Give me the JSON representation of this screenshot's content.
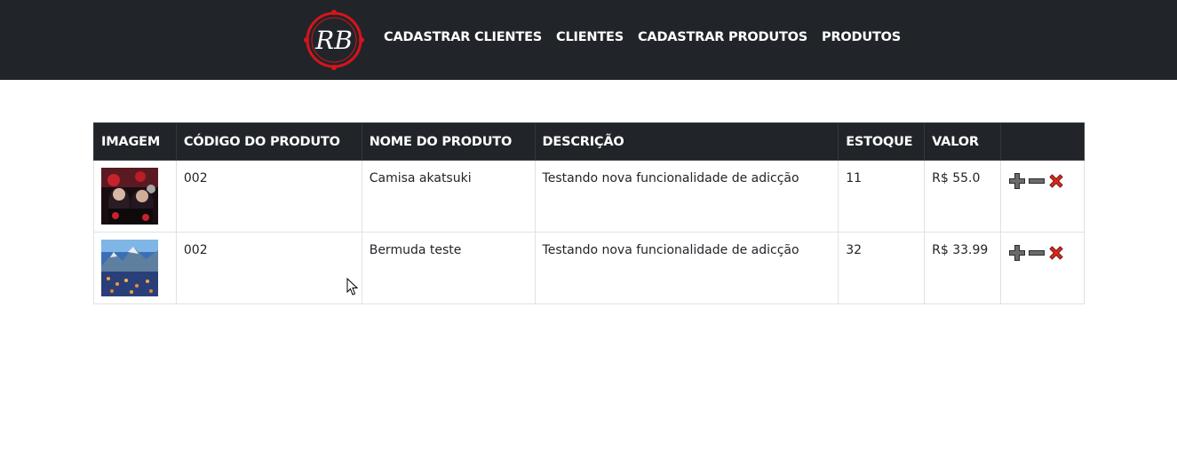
{
  "navbar": {
    "logo_text": "RB",
    "links": [
      {
        "label": "CADASTRAR CLIENTES"
      },
      {
        "label": "CLIENTES"
      },
      {
        "label": "CADASTRAR PRODUTOS"
      },
      {
        "label": "PRODUTOS"
      }
    ]
  },
  "table": {
    "headers": {
      "image": "IMAGEM",
      "code": "CÓDIGO DO PRODUTO",
      "name": "NOME DO PRODUTO",
      "description": "DESCRIÇÃO",
      "stock": "ESTOQUE",
      "price": "VALOR",
      "actions": ""
    },
    "rows": [
      {
        "image_alt": "akatsuki-shirt-image",
        "code": "002",
        "name": "Camisa akatsuki",
        "description": "Testando nova funcionalidade de adicção",
        "stock": "11",
        "price": "R$ 55.0"
      },
      {
        "image_alt": "landscape-image",
        "code": "002",
        "name": "Bermuda teste",
        "description": "Testando nova funcionalidade de adicção",
        "stock": "32",
        "price": "R$ 33.99"
      }
    ]
  },
  "colors": {
    "navbar_bg": "#212529",
    "logo_accent": "#d9131a",
    "delete_icon": "#d72b1f"
  },
  "icons": [
    "plus-icon",
    "minus-icon",
    "close-icon",
    "mouse-cursor-icon"
  ]
}
